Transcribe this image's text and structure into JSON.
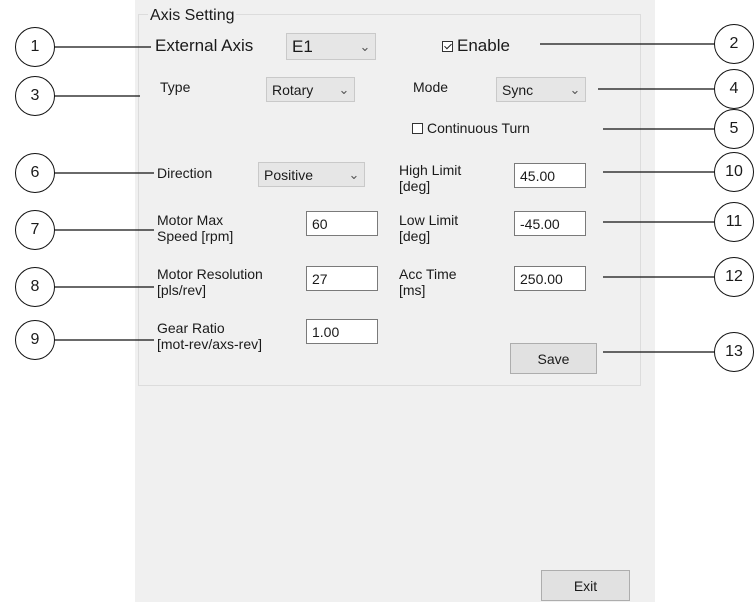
{
  "group_title": "Axis Setting",
  "external_axis": {
    "label": "External Axis",
    "value": "E1"
  },
  "enable": {
    "label": "Enable",
    "checked": true
  },
  "type": {
    "label": "Type",
    "value": "Rotary"
  },
  "mode": {
    "label": "Mode",
    "value": "Sync"
  },
  "continuous_turn": {
    "label": "Continuous Turn",
    "checked": false
  },
  "direction": {
    "label": "Direction",
    "value": "Positive"
  },
  "motor_max_speed": {
    "label_line1": "Motor Max",
    "label_line2": "Speed [rpm]",
    "value": "60"
  },
  "motor_resolution": {
    "label_line1": "Motor Resolution",
    "label_line2": "[pls/rev]",
    "value": "27"
  },
  "gear_ratio": {
    "label_line1": "Gear Ratio",
    "label_line2": "[mot-rev/axs-rev]",
    "value": "1.00"
  },
  "high_limit": {
    "label_line1": "High Limit",
    "label_line2": "[deg]",
    "value": "45.00"
  },
  "low_limit": {
    "label_line1": "Low Limit",
    "label_line2": "[deg]",
    "value": "-45.00"
  },
  "acc_time": {
    "label_line1": "Acc Time",
    "label_line2": "[ms]",
    "value": "250.00"
  },
  "save_label": "Save",
  "exit_label": "Exit",
  "callouts": [
    "1",
    "2",
    "3",
    "4",
    "5",
    "6",
    "7",
    "8",
    "9",
    "10",
    "11",
    "12",
    "13"
  ]
}
